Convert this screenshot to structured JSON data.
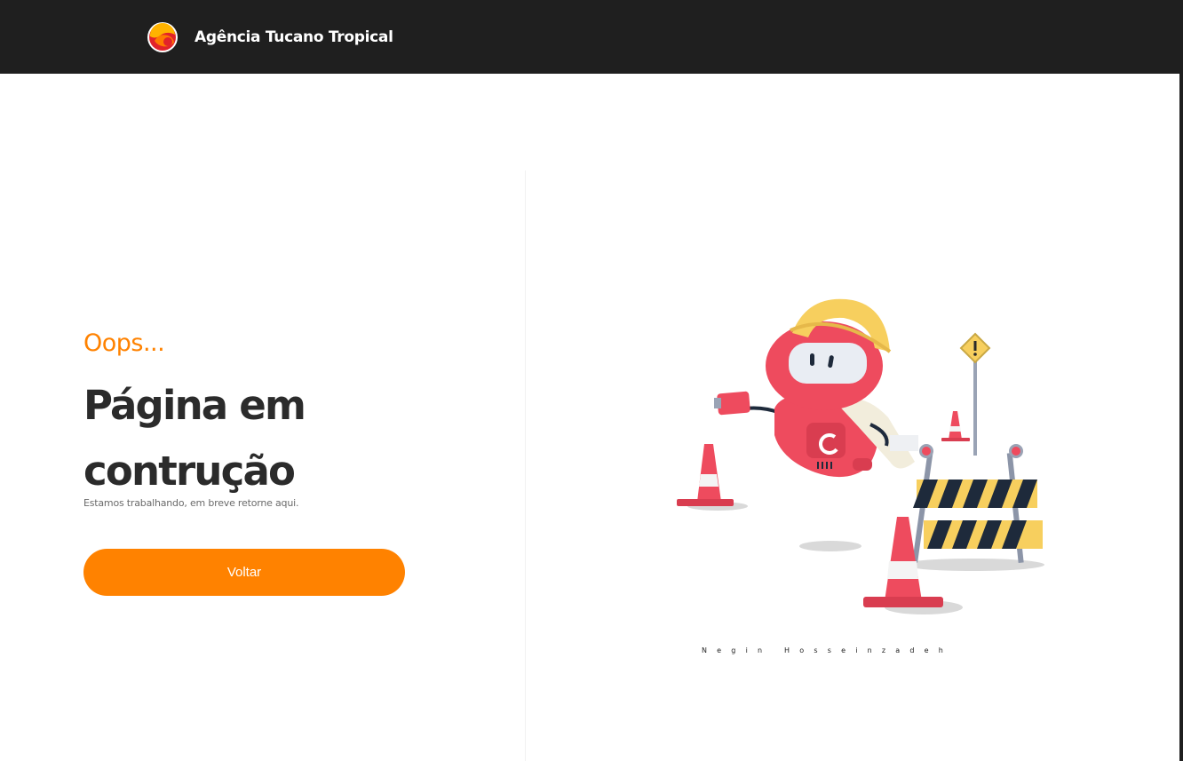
{
  "header": {
    "brand_name": "Agência Tucano Tropical",
    "logo_icon": "toucan-sun-logo-icon",
    "background": "#1f1f1f"
  },
  "hero": {
    "eyebrow": "Oops...",
    "title": "Página em contrução",
    "subtitle": "Estamos trabalhando, em breve retorne aqui.",
    "button_label": "Voltar",
    "accent_color": "#ff8200"
  },
  "illustration": {
    "icon": "construction-robot-icon",
    "credit": "Negin Hosseinzadeh"
  }
}
